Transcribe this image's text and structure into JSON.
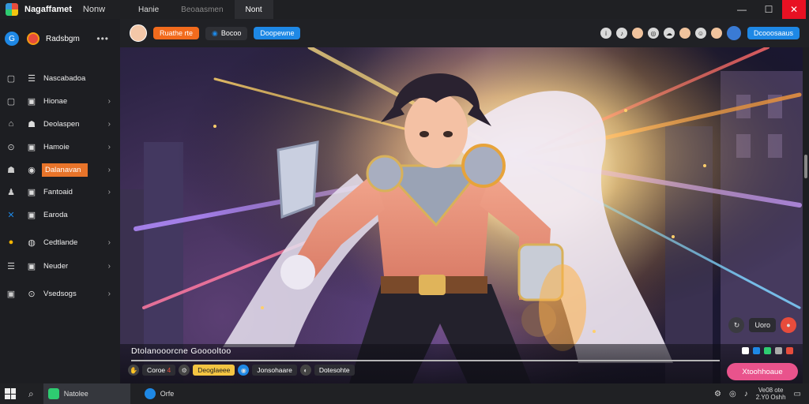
{
  "titlebar": {
    "app_name": "Nagaffamet",
    "menu_label": "Nonw",
    "tabs": [
      "Hanie",
      "Beoaasmen",
      "Nont"
    ],
    "minimize": "—",
    "maximize": "☐",
    "close": "✕"
  },
  "sidebar": {
    "user_name": "Radsbgm",
    "more": "•••",
    "items": [
      {
        "label": "Nascabadoa",
        "icon": "☰",
        "left_icon": "▢"
      },
      {
        "label": "Hionae",
        "icon": "▣",
        "left_icon": "▢"
      },
      {
        "label": "Deolaspen",
        "icon": "☗",
        "left_icon": "⌂"
      },
      {
        "label": "Hamoie",
        "icon": "▣",
        "left_icon": "⊙"
      },
      {
        "label": "Dalanavan",
        "icon": "◉",
        "left_icon": "☗"
      },
      {
        "label": "Fantoaid",
        "icon": "▣",
        "left_icon": "♟"
      },
      {
        "label": "Earoda",
        "icon": "▣",
        "left_icon": "✕"
      },
      {
        "label": "Cedtlande",
        "icon": "◍",
        "left_icon": "●"
      },
      {
        "label": "Neuder",
        "icon": "▣",
        "left_icon": "☰"
      },
      {
        "label": "Vsedsogs",
        "icon": "⊙",
        "left_icon": "▣"
      }
    ]
  },
  "toolbar": {
    "primary_chip": "Ruathe rte",
    "chip_2": "Bocoo",
    "chip_3": "Doopewne",
    "right_button": "Dcooosaaus"
  },
  "stage": {
    "controls_label": "Uoro"
  },
  "overlay": {
    "title": "Dtolanooorcne Gooooltoo",
    "pill_1": "Coroe",
    "pill_1_count": "4",
    "pill_2": "Deoglaeee",
    "pill_3": "Jonsohaare",
    "pill_4": "Dotesohte",
    "cta": "Xtoohhoaue"
  },
  "taskbar": {
    "app_1": "Natolee",
    "app_2": "Orfe",
    "clock_time": "Ve08 ote",
    "clock_date": "2.Y0 Oshh"
  },
  "colors": {
    "accent_orange": "#f26b1d",
    "accent_blue": "#1e88e5",
    "accent_pink": "#e9538c"
  }
}
